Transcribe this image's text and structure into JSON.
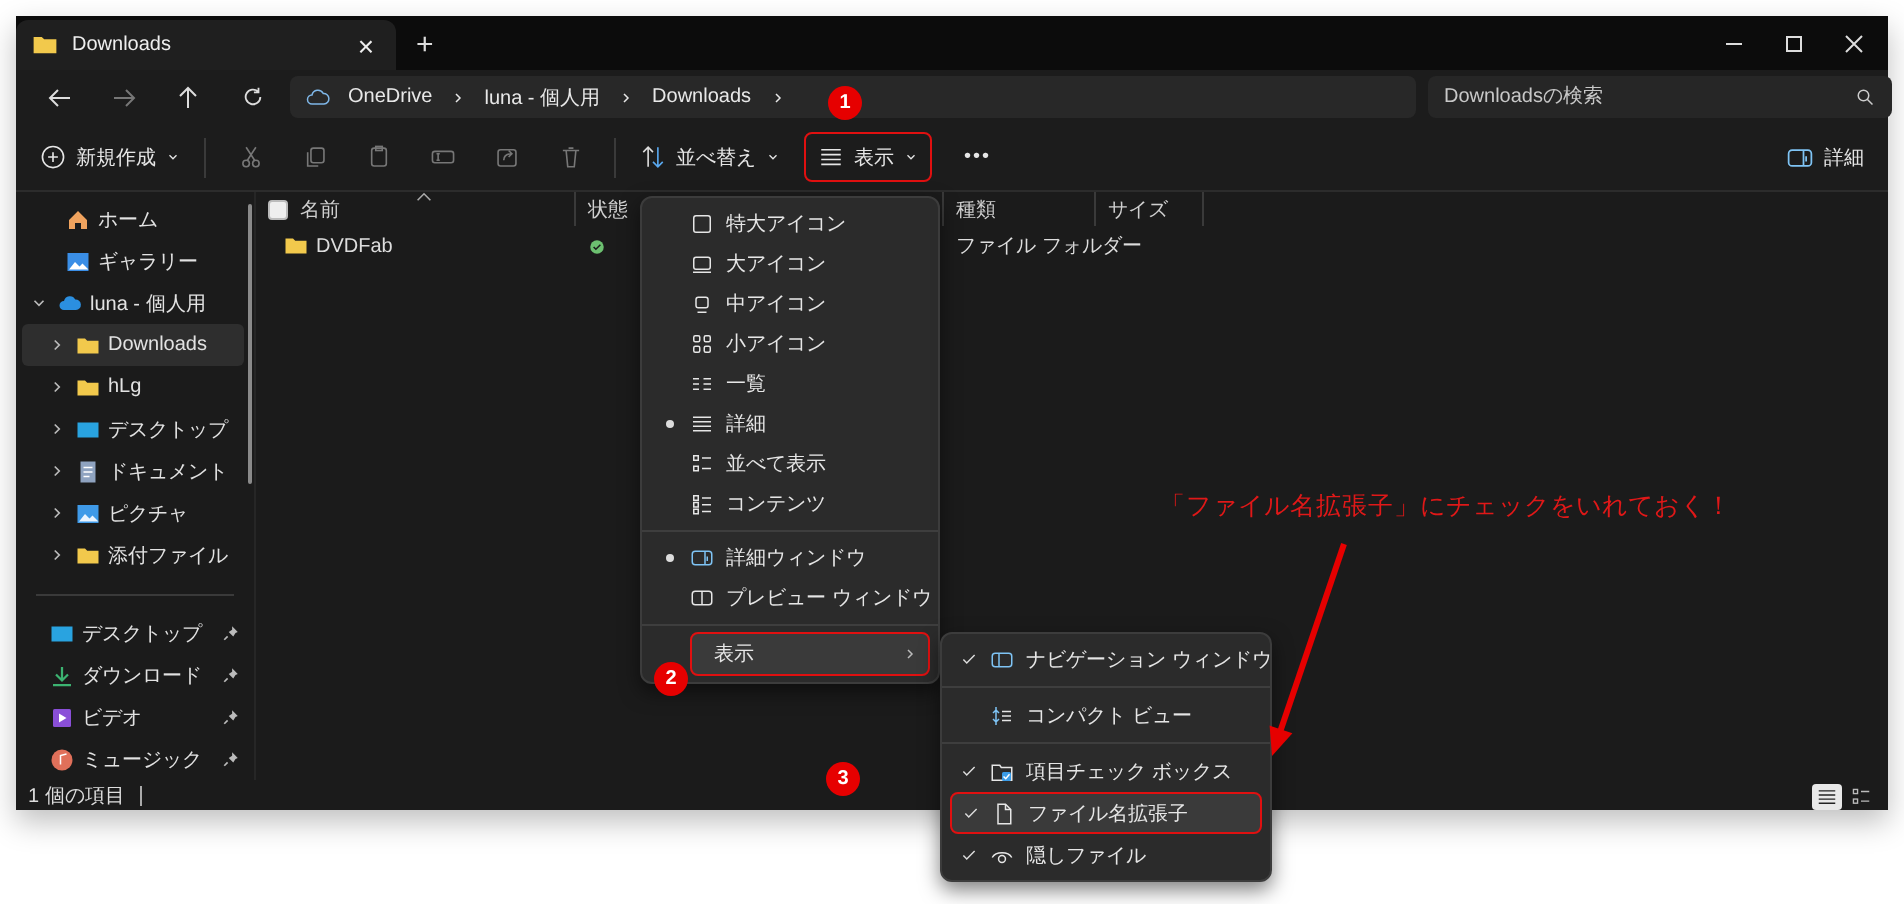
{
  "window": {
    "tab_title": "Downloads",
    "tab_close": "×",
    "new_tab": "+"
  },
  "address_bar": {
    "breadcrumb": [
      "OneDrive",
      "luna - 個人用",
      "Downloads"
    ],
    "search": {
      "placeholder": "Downloadsの検索"
    }
  },
  "command_bar": {
    "new_button": {
      "label": "新規作成"
    },
    "sort_button": {
      "label": "並べ替え"
    },
    "view_button": {
      "label": "表示",
      "highlighted": true
    },
    "more_button": "•••",
    "details_button": {
      "label": "詳細"
    }
  },
  "sidebar": {
    "items": [
      {
        "label": "ホーム",
        "kind": "home",
        "selected": false
      },
      {
        "label": "ギャラリー",
        "kind": "gallery",
        "selected": false
      },
      {
        "label": "luna - 個人用",
        "kind": "cloud",
        "selected": false,
        "expanded": true,
        "children": [
          {
            "label": "Downloads",
            "kind": "folder",
            "selected": true,
            "expanded": false
          },
          {
            "label": "hLg",
            "kind": "folder",
            "selected": false,
            "expanded": false
          },
          {
            "label": "デスクトップ",
            "kind": "desktop",
            "selected": false,
            "expanded": false
          },
          {
            "label": "ドキュメント",
            "kind": "document",
            "selected": false,
            "expanded": false
          },
          {
            "label": "ピクチャ",
            "kind": "pictures",
            "selected": false,
            "expanded": false
          },
          {
            "label": "添付ファイル",
            "kind": "folder",
            "selected": false,
            "expanded": false
          }
        ]
      }
    ],
    "quick_access": [
      {
        "label": "デスクトップ",
        "kind": "desktop",
        "pinned": true,
        "selected": false
      },
      {
        "label": "ダウンロード",
        "kind": "download",
        "pinned": true,
        "selected": false
      },
      {
        "label": "ビデオ",
        "kind": "video",
        "pinned": true,
        "selected": false
      },
      {
        "label": "ミュージック",
        "kind": "music",
        "pinned": true,
        "selected": false
      }
    ]
  },
  "file_list": {
    "select_all": {
      "checked": false
    },
    "columns": [
      "名前",
      "状態",
      "種類",
      "サイズ"
    ],
    "rows": [
      {
        "name": "DVDFab",
        "type": "ファイル フォルダー"
      }
    ]
  },
  "status_bar": {
    "item_count": "1 個の項目",
    "view_toggles": [
      {
        "kind": "details",
        "selected": true
      },
      {
        "kind": "tiles",
        "selected": false
      }
    ]
  },
  "view_menu": {
    "sections": [
      [
        {
          "label": "特大アイコン",
          "kind": "xl",
          "selected": false
        },
        {
          "label": "大アイコン",
          "kind": "large",
          "selected": false
        },
        {
          "label": "中アイコン",
          "kind": "medium",
          "selected": false
        },
        {
          "label": "小アイコン",
          "kind": "small",
          "selected": false
        },
        {
          "label": "一覧",
          "kind": "list",
          "selected": false
        },
        {
          "label": "詳細",
          "kind": "details",
          "selected": true
        },
        {
          "label": "並べて表示",
          "kind": "tiles",
          "selected": false
        },
        {
          "label": "コンテンツ",
          "kind": "content",
          "selected": false
        }
      ],
      [
        {
          "label": "詳細ウィンドウ",
          "kind": "details-pane",
          "selected": true
        },
        {
          "label": "プレビュー ウィンドウ",
          "kind": "preview-pane",
          "selected": false
        }
      ]
    ],
    "submenu_item": {
      "label": "表示",
      "highlighted": true
    }
  },
  "show_submenu": {
    "sections": [
      [
        {
          "label": "ナビゲーション ウィンドウ",
          "kind": "nav-pane",
          "checked": true,
          "highlighted": false
        }
      ],
      [
        {
          "label": "コンパクト ビュー",
          "kind": "compact",
          "checked": false,
          "highlighted": false
        }
      ],
      [
        {
          "label": "項目チェック ボックス",
          "kind": "item-check",
          "checked": true,
          "highlighted": false
        },
        {
          "label": "ファイル名拡張子",
          "kind": "file",
          "checked": true,
          "highlighted": true
        },
        {
          "label": "隠しファイル",
          "kind": "eye",
          "checked": true,
          "highlighted": false
        }
      ]
    ]
  },
  "annotations": {
    "step_badges": [
      "1",
      "2",
      "3"
    ],
    "callout": "「ファイル名拡張子」にチェックをいれておく！"
  }
}
